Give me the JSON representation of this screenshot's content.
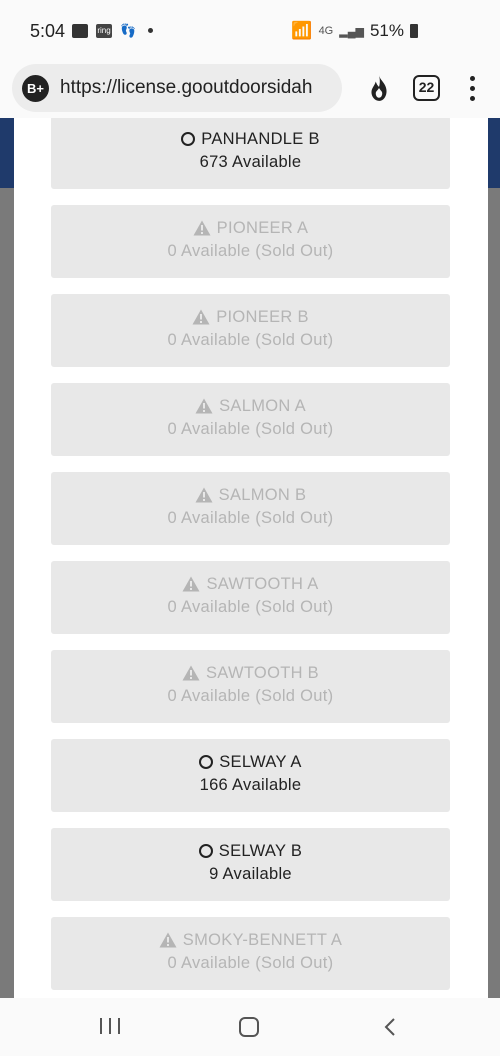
{
  "status": {
    "time": "5:04",
    "network": "4G",
    "battery": "51%"
  },
  "browser": {
    "badge": "B+",
    "url": "https://license.gooutdoorsidah",
    "tab_count": "22"
  },
  "units": [
    {
      "name": "PANHANDLE B",
      "availability": "673 Available",
      "sold_out": false
    },
    {
      "name": "PIONEER A",
      "availability": "0 Available (Sold Out)",
      "sold_out": true
    },
    {
      "name": "PIONEER B",
      "availability": "0 Available (Sold Out)",
      "sold_out": true
    },
    {
      "name": "SALMON A",
      "availability": "0 Available (Sold Out)",
      "sold_out": true
    },
    {
      "name": "SALMON B",
      "availability": "0 Available (Sold Out)",
      "sold_out": true
    },
    {
      "name": "SAWTOOTH A",
      "availability": "0 Available (Sold Out)",
      "sold_out": true
    },
    {
      "name": "SAWTOOTH B",
      "availability": "0 Available (Sold Out)",
      "sold_out": true
    },
    {
      "name": "SELWAY A",
      "availability": "166 Available",
      "sold_out": false
    },
    {
      "name": "SELWAY B",
      "availability": "9 Available",
      "sold_out": false
    },
    {
      "name": "SMOKY-BENNETT A",
      "availability": "0 Available (Sold Out)",
      "sold_out": true
    }
  ],
  "colors": {
    "banner": "#1f3a6b",
    "card_bg": "#e8e8e8",
    "available_text": "#222222",
    "sold_out_text": "#b5b5b5"
  },
  "icons": {
    "available": "circle-outline-icon",
    "sold_out": "warning-triangle-icon"
  }
}
